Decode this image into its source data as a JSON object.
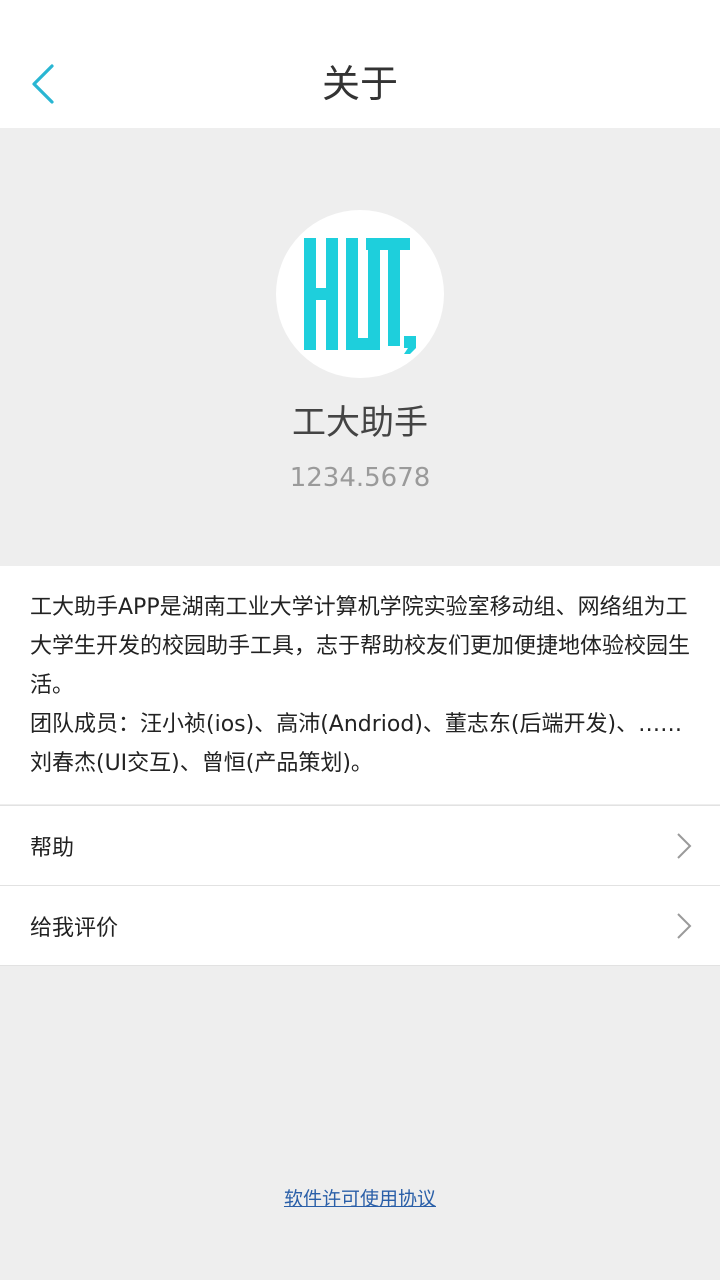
{
  "header": {
    "title": "关于",
    "back_icon": "chevron-left-icon",
    "accent_color": "#29b6d3"
  },
  "app": {
    "logo_icon": "hut-logo-icon",
    "logo_color": "#1ecfdc",
    "name": "工大助手",
    "version": "1234.5678"
  },
  "description": {
    "intro": "工大助手APP是湖南工业大学计算机学院实验室移动组、网络组为工大学生开发的校园助手工具，志于帮助校友们更加便捷地体验校园生活。",
    "team": "团队成员：汪小祯(ios)、高沛(Andriod)、董志东(后端开发)、……刘春杰(UI交互)、曾恒(产品策划)。"
  },
  "menu": {
    "items": [
      {
        "label": "帮助",
        "icon": "chevron-right-icon"
      },
      {
        "label": "给我评价",
        "icon": "chevron-right-icon"
      }
    ]
  },
  "footer": {
    "license_link": "软件许可使用协议"
  }
}
